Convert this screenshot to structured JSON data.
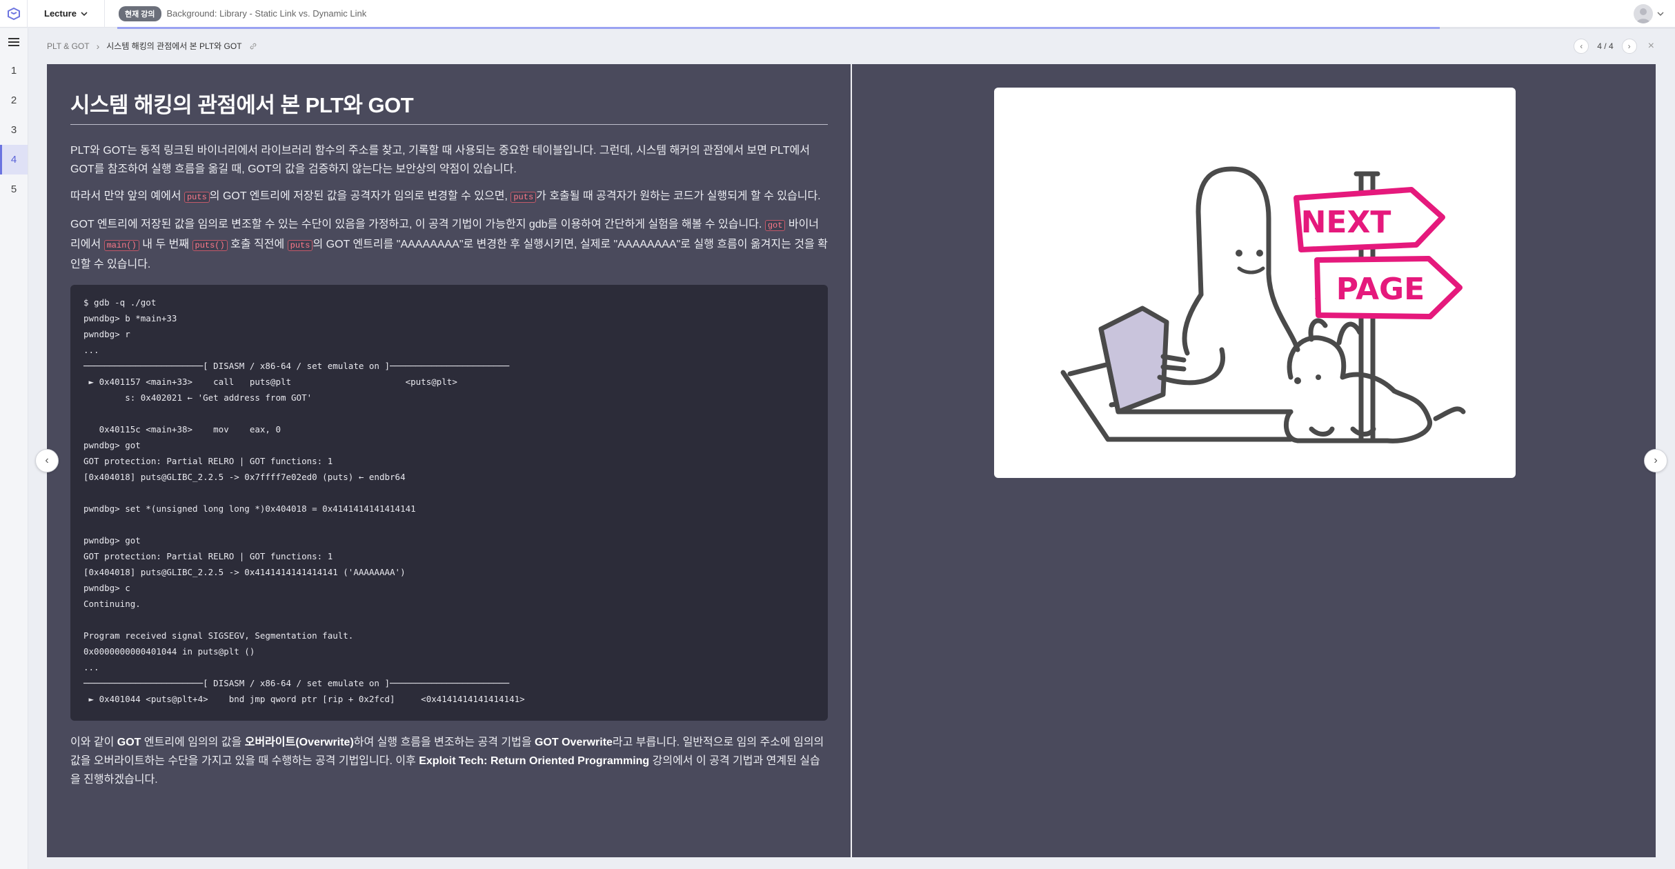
{
  "topbar": {
    "lecture_label": "Lecture",
    "current_badge": "현재 강의",
    "current_title": "Background: Library - Static Link vs. Dynamic Link"
  },
  "rail": {
    "items": [
      "1",
      "2",
      "3",
      "4",
      "5"
    ],
    "active_index": 3
  },
  "breadcrumb": {
    "parent": "PLT & GOT",
    "current": "시스템 해킹의 관점에서 본 PLT와 GOT"
  },
  "pager": {
    "label": "4 / 4"
  },
  "content": {
    "heading": "시스템 해킹의 관점에서 본 PLT와 GOT",
    "p1": "PLT와 GOT는 동적 링크된 바이너리에서 라이브러리 함수의 주소를 찾고, 기록할 때 사용되는 중요한 테이블입니다. 그런데, 시스템 해커의 관점에서 보면 PLT에서 GOT를 참조하여 실행 흐름을 옮길 때, GOT의 값을 검증하지 않는다는 보안상의 약점이 있습니다.",
    "p2": {
      "a": "따라서 만약 앞의 예에서 ",
      "code1": "puts",
      "b": "의 GOT 엔트리에 저장된 값을 공격자가 임의로 변경할 수 있으면, ",
      "code2": "puts",
      "c": "가 호출될 때 공격자가 원하는 코드가 실행되게 할 수 있습니다."
    },
    "p3": {
      "a": "GOT 엔트리에 저장된 값을 임의로 변조할 수 있는 수단이 있음을 가정하고, 이 공격 기법이 가능한지 gdb를 이용하여 간단하게 실험을 해볼 수 있습니다. ",
      "code1": "got",
      "b": " 바이너리에서 ",
      "code2": "main()",
      "c": " 내 두 번째 ",
      "code3": "puts()",
      "d": " 호출 직전에 ",
      "code4": "puts",
      "e": "의 GOT 엔트리를 \"AAAAAAAA\"로 변경한 후 실행시키면, 실제로 \"AAAAAAAA\"로 실행 흐름이 옮겨지는 것을 확인할 수 있습니다."
    },
    "code": "$ gdb -q ./got\npwndbg> b *main+33\npwndbg> r\n...\n───────────────────────[ DISASM / x86-64 / set emulate on ]───────────────────────\n ► 0x401157 <main+33>    call   puts@plt                      <puts@plt>\n        s: 0x402021 ← 'Get address from GOT'\n\n   0x40115c <main+38>    mov    eax, 0\npwndbg> got\nGOT protection: Partial RELRO | GOT functions: 1\n[0x404018] puts@GLIBC_2.2.5 -> 0x7ffff7e02ed0 (puts) ← endbr64\n\npwndbg> set *(unsigned long long *)0x404018 = 0x4141414141414141\n\npwndbg> got\nGOT protection: Partial RELRO | GOT functions: 1\n[0x404018] puts@GLIBC_2.2.5 -> 0x4141414141414141 ('AAAAAAAA')\npwndbg> c\nContinuing.\n\nProgram received signal SIGSEGV, Segmentation fault.\n0x0000000000401044 in puts@plt ()\n...\n───────────────────────[ DISASM / x86-64 / set emulate on ]───────────────────────\n ► 0x401044 <puts@plt+4>    bnd jmp qword ptr [rip + 0x2fcd]     <0x4141414141414141>",
    "p4": {
      "a": "이와 같이 ",
      "b1": "GOT",
      "b": " 엔트리에 임의의 값을 ",
      "b2": "오버라이트(Overwrite)",
      "c": "하여 실행 흐름을 변조하는 공격 기법을 ",
      "b3": "GOT Overwrite",
      "d": "라고 부릅니다. 일반적으로 임의 주소에 임의의 값을 오버라이트하는 수단을 가지고 있을 때 수행하는 공격 기법입니다. 이후 ",
      "b4": "Exploit Tech: Return Oriented Programming",
      "e": " 강의에서 이 공격 기법과 연계된 실습을 진행하겠습니다."
    }
  },
  "illustration": {
    "sign_top": "NEXT",
    "sign_bottom": "PAGE",
    "accent": "#e5197c"
  },
  "colors": {
    "slide_bg": "#4a4a5c",
    "code_bg": "#2c2c39",
    "inline_code": "#ff7a8a",
    "active_rail": "#5a63d8"
  }
}
